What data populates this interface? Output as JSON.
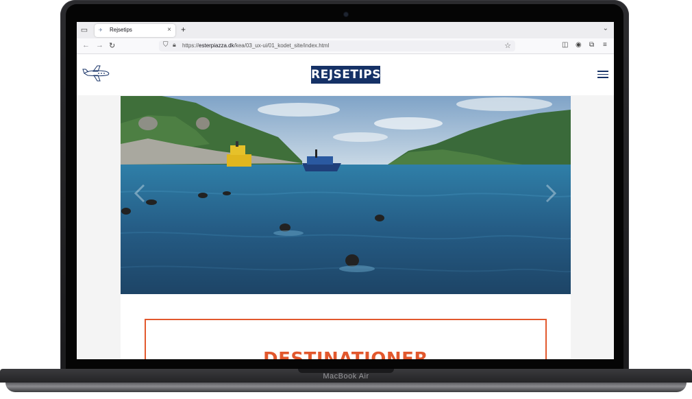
{
  "device": {
    "brand_label": "MacBook Air"
  },
  "browser": {
    "tab": {
      "title": "Rejsetips",
      "favicon": "site-favicon"
    },
    "new_tab_glyph": "+",
    "tab_close_glyph": "×",
    "url": {
      "prefix": "https://",
      "host": "esterpiazza.dk",
      "path": "/kea/03_ux-ui/01_kodet_site/index.html"
    }
  },
  "site": {
    "logo_text": "REJSETIPS",
    "plane_icon": "airplane-icon",
    "menu_icon": "hamburger-menu-icon",
    "hero_alt_scene": "sea-boats-swimmers",
    "section_title": "DESTINATIONER"
  },
  "colors": {
    "brand_navy": "#153166",
    "accent_orange": "#e2582d",
    "sea": "#2a5f86",
    "sky": "#a9c6de"
  }
}
